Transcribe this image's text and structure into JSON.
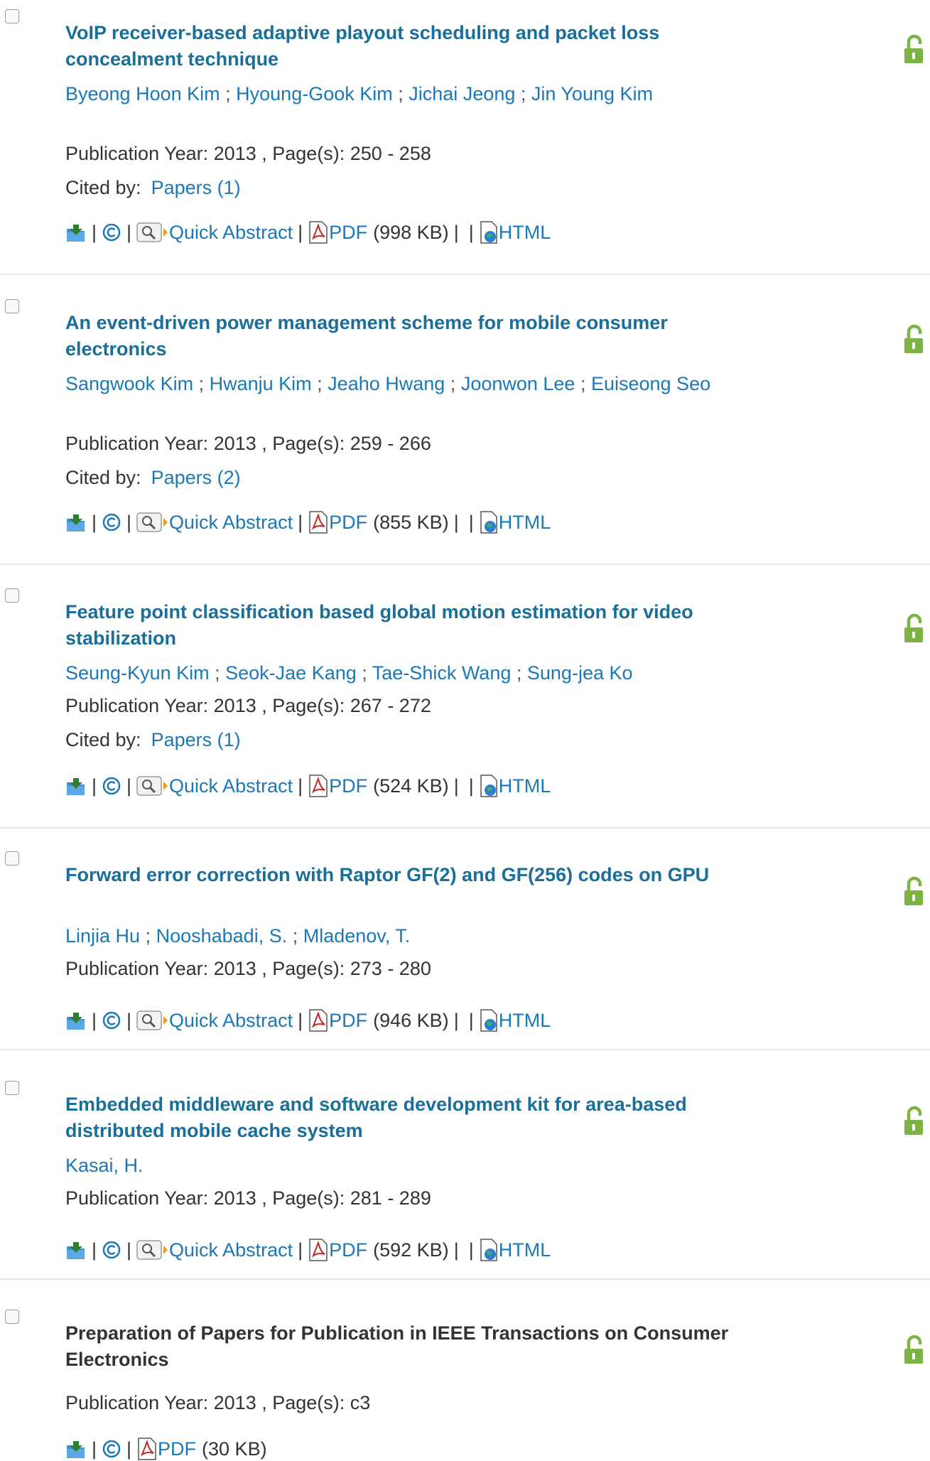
{
  "colors": {
    "link": "#1a78b8",
    "title_link": "#1a6e9a",
    "text": "#333333",
    "lock": "#7cb342",
    "pdf_red": "#c62828"
  },
  "icons": {
    "checkbox": "checkbox-icon",
    "open_access": "open-lock-icon",
    "download": "download-folder-icon",
    "copyright": "copyright-icon",
    "quick_abstract": "magnifier-icon",
    "pdf": "pdf-icon",
    "html": "html-globe-icon"
  },
  "labels": {
    "quick_abstract": "Quick Abstract",
    "pdf": "PDF",
    "html": "HTML",
    "cited_by": "Cited by:",
    "pipe": "|"
  },
  "entries": [
    {
      "title": "VoIP receiver-based adaptive playout scheduling and packet loss concealment technique",
      "title_is_link": true,
      "authors": [
        "Byeong Hoon Kim",
        "Hyoung-Gook Kim",
        "Jichai Jeong",
        "Jin Young Kim"
      ],
      "publication": "Publication Year: 2013 , Page(s): 250 - 258",
      "cited_by": "Papers (1)",
      "pdf_size": "(998 KB)",
      "has_quick_abstract": true,
      "has_html": true
    },
    {
      "title": "An event-driven power management scheme for mobile consumer electronics",
      "title_is_link": true,
      "authors": [
        "Sangwook Kim",
        "Hwanju Kim",
        "Jeaho Hwang",
        "Joonwon Lee",
        "Euiseong Seo"
      ],
      "publication": "Publication Year: 2013 , Page(s): 259 - 266",
      "cited_by": "Papers (2)",
      "pdf_size": "(855 KB)",
      "has_quick_abstract": true,
      "has_html": true
    },
    {
      "title": "Feature point classification based global motion estimation for video stabilization",
      "title_is_link": true,
      "authors": [
        "Seung-Kyun Kim",
        "Seok-Jae Kang",
        "Tae-Shick Wang",
        "Sung-jea Ko"
      ],
      "publication": "Publication Year: 2013 , Page(s): 267 - 272",
      "cited_by": "Papers (1)",
      "pdf_size": "(524 KB)",
      "has_quick_abstract": true,
      "has_html": true
    },
    {
      "title": "Forward error correction with Raptor GF(2) and GF(256) codes on GPU",
      "title_is_link": true,
      "authors": [
        "Linjia Hu",
        "Nooshabadi, S.",
        "Mladenov, T."
      ],
      "publication": "Publication Year: 2013 , Page(s): 273 - 280",
      "cited_by": null,
      "pdf_size": "(946 KB)",
      "has_quick_abstract": true,
      "has_html": true
    },
    {
      "title": "Embedded middleware and software development kit for area-based distributed mobile cache system",
      "title_is_link": true,
      "authors": [
        "Kasai, H."
      ],
      "publication": "Publication Year: 2013 , Page(s): 281 - 289",
      "cited_by": null,
      "pdf_size": "(592 KB)",
      "has_quick_abstract": true,
      "has_html": true
    },
    {
      "title": "Preparation of Papers for Publication in IEEE Transactions on Consumer Electronics",
      "title_is_link": false,
      "authors": [],
      "publication": "Publication Year: 2013 , Page(s): c3",
      "cited_by": null,
      "pdf_size": "(30 KB)",
      "has_quick_abstract": false,
      "has_html": false
    }
  ]
}
